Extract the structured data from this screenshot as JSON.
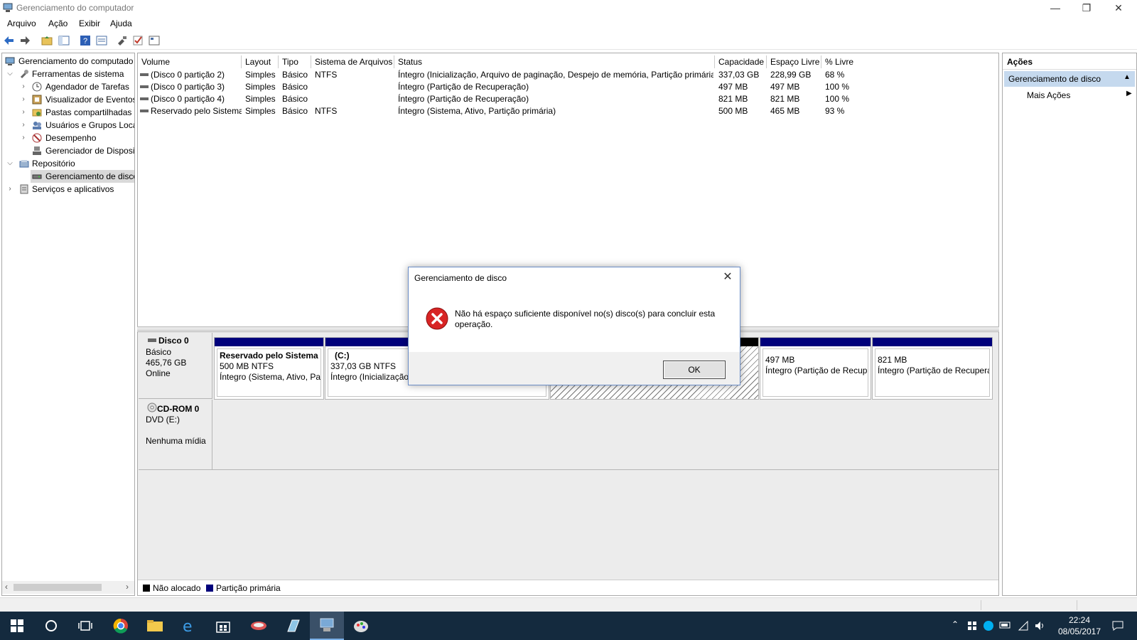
{
  "window": {
    "title": "Gerenciamento do computador",
    "minimize": "—",
    "restore": "❐",
    "close": "✕"
  },
  "menu": [
    "Arquivo",
    "Ação",
    "Exibir",
    "Ajuda"
  ],
  "toolbar": [
    "back-icon",
    "forward-icon",
    "up-folder-icon",
    "show-hide-tree-icon",
    "help-icon",
    "properties-icon",
    "connect-icon",
    "check-icon",
    "view-icon"
  ],
  "tree": [
    {
      "label": "Gerenciamento do computado",
      "level": 0,
      "arrow": "",
      "icon": "computer-management-icon"
    },
    {
      "label": "Ferramentas de sistema",
      "level": 1,
      "arrow": "v",
      "icon": "tools-icon"
    },
    {
      "label": "Agendador de Tarefas",
      "level": 2,
      "arrow": ">",
      "icon": "clock-icon"
    },
    {
      "label": "Visualizador de Eventos",
      "level": 2,
      "arrow": ">",
      "icon": "event-viewer-icon"
    },
    {
      "label": "Pastas compartilhadas",
      "level": 2,
      "arrow": ">",
      "icon": "shared-folder-icon"
    },
    {
      "label": "Usuários e Grupos Loca",
      "level": 2,
      "arrow": ">",
      "icon": "users-icon"
    },
    {
      "label": "Desempenho",
      "level": 2,
      "arrow": ">",
      "icon": "performance-icon"
    },
    {
      "label": "Gerenciador de Disposit",
      "level": 2,
      "arrow": "",
      "icon": "device-manager-icon"
    },
    {
      "label": "Repositório",
      "level": 1,
      "arrow": "v",
      "icon": "storage-icon"
    },
    {
      "label": "Gerenciamento de disco",
      "level": 2,
      "arrow": "",
      "icon": "disk-icon",
      "selected": true
    },
    {
      "label": "Serviços e aplicativos",
      "level": 1,
      "arrow": ">",
      "icon": "services-icon"
    }
  ],
  "volumes": {
    "columns": [
      "Volume",
      "Layout",
      "Tipo",
      "Sistema de Arquivos",
      "Status",
      "Capacidade",
      "Espaço Livre",
      "% Livre"
    ],
    "rows": [
      [
        "(Disco 0 partição 2)",
        "Simples",
        "Básico",
        "NTFS",
        "Íntegro (Inicialização, Arquivo de paginação, Despejo de memória, Partição primária)",
        "337,03 GB",
        "228,99 GB",
        "68 %"
      ],
      [
        "(Disco 0 partição 3)",
        "Simples",
        "Básico",
        "",
        "Íntegro (Partição de Recuperação)",
        "497 MB",
        "497 MB",
        "100 %"
      ],
      [
        "(Disco 0 partição 4)",
        "Simples",
        "Básico",
        "",
        "Íntegro (Partição de Recuperação)",
        "821 MB",
        "821 MB",
        "100 %"
      ],
      [
        "Reservado pelo Sistema",
        "Simples",
        "Básico",
        "NTFS",
        "Íntegro (Sistema, Ativo, Partição primária)",
        "500 MB",
        "465 MB",
        "93 %"
      ]
    ]
  },
  "disk0": {
    "name": "Disco 0",
    "type": "Básico",
    "size": "465,76 GB",
    "state": "Online",
    "partitions": [
      {
        "name": "Reservado pelo Sistema",
        "size": "500 MB NTFS",
        "status": "Íntegro (Sistema, Ativo, Pa"
      },
      {
        "name": "(C:)",
        "size": "337,03 GB NTFS",
        "status": "Íntegro (Inicialização"
      },
      {
        "name": "",
        "size": "",
        "status": ""
      },
      {
        "name": "",
        "size": "497 MB",
        "status": "Íntegro (Partição de Recup"
      },
      {
        "name": "",
        "size": "821 MB",
        "status": "Íntegro (Partição de Recupera"
      }
    ]
  },
  "cdrom": {
    "name": "CD-ROM 0",
    "drive": "DVD (E:)",
    "media": "Nenhuma mídia"
  },
  "legend": [
    {
      "label": "Não alocado",
      "color": "#000000"
    },
    {
      "label": "Partição primária",
      "color": "#00007b"
    }
  ],
  "actions": {
    "title": "Ações",
    "section": "Gerenciamento de disco",
    "more": "Mais Ações"
  },
  "dialog": {
    "title": "Gerenciamento de disco",
    "message": "Não há espaço suficiente disponível no(s) disco(s) para concluir esta operação.",
    "ok": "OK"
  },
  "taskbar": {
    "time": "22:24",
    "date": "08/05/2017"
  }
}
